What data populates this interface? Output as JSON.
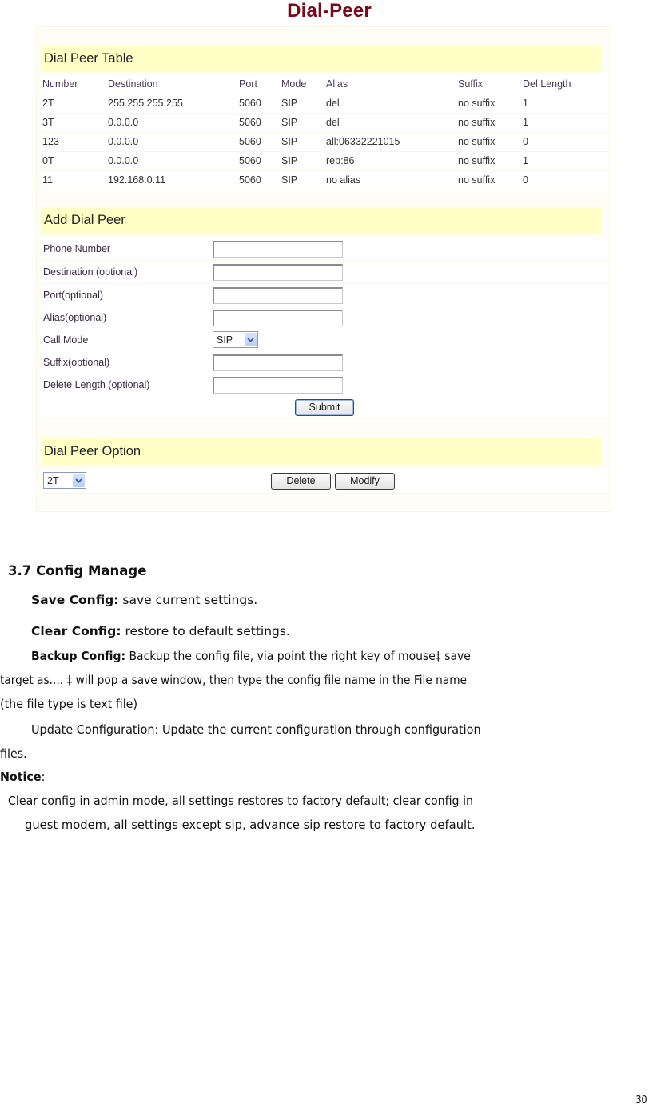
{
  "page_title": "Dial-Peer",
  "dial_peer_table": {
    "heading": "Dial Peer Table",
    "columns": [
      "Number",
      "Destination",
      "Port",
      "Mode",
      "Alias",
      "Suffix",
      "Del Length"
    ],
    "rows": [
      [
        "2T",
        "255.255.255.255",
        "5060",
        "SIP",
        "del",
        "no suffix",
        "1"
      ],
      [
        "3T",
        "0.0.0.0",
        "5060",
        "SIP",
        "del",
        "no suffix",
        "1"
      ],
      [
        "123",
        "0.0.0.0",
        "5060",
        "SIP",
        "all:06332221015",
        "no suffix",
        "0"
      ],
      [
        "0T",
        "0.0.0.0",
        "5060",
        "SIP",
        "rep:86",
        "no suffix",
        "1"
      ],
      [
        "11",
        "192.168.0.11",
        "5060",
        "SIP",
        "no alias",
        "no suffix",
        "0"
      ]
    ]
  },
  "add_dial_peer": {
    "heading": "Add Dial Peer",
    "fields": {
      "phone_number": {
        "label": "Phone Number",
        "value": ""
      },
      "destination": {
        "label": "Destination (optional)",
        "value": ""
      },
      "port": {
        "label": "Port(optional)",
        "value": ""
      },
      "alias": {
        "label": "Alias(optional)",
        "value": ""
      },
      "call_mode": {
        "label": "Call Mode",
        "value": "SIP"
      },
      "suffix": {
        "label": "Suffix(optional)",
        "value": ""
      },
      "delete_length": {
        "label": "Delete Length (optional)",
        "value": ""
      }
    },
    "submit_label": "Submit"
  },
  "dial_peer_option": {
    "heading": "Dial Peer Option",
    "selected": "2T",
    "delete_label": "Delete",
    "modify_label": "Modify"
  },
  "doc": {
    "section_heading": "3.7 Config Manage",
    "save_config": {
      "term": "Save Config:",
      "text": " save current settings."
    },
    "clear_config": {
      "term": "Clear Config:",
      "text": " restore to default settings."
    },
    "backup_config": {
      "term": "Backup Config:",
      "line1": " Backup the config file, via point the right key of mouse‡   save",
      "line2": "target as.... ‡  will pop a save window, then type the config file name in the File name",
      "line3": "(the file type is text file)"
    },
    "update_config": {
      "line1": "Update Configuration: Update the current configuration through configuration",
      "line2": "files."
    },
    "notice": {
      "term": "Notice",
      "colon": ":",
      "line1": "Clear config in admin mode, all settings restores to factory default; clear config in",
      "line2": "guest modem, all settings except sip, advance sip restore to factory default."
    }
  },
  "page_number": "30"
}
